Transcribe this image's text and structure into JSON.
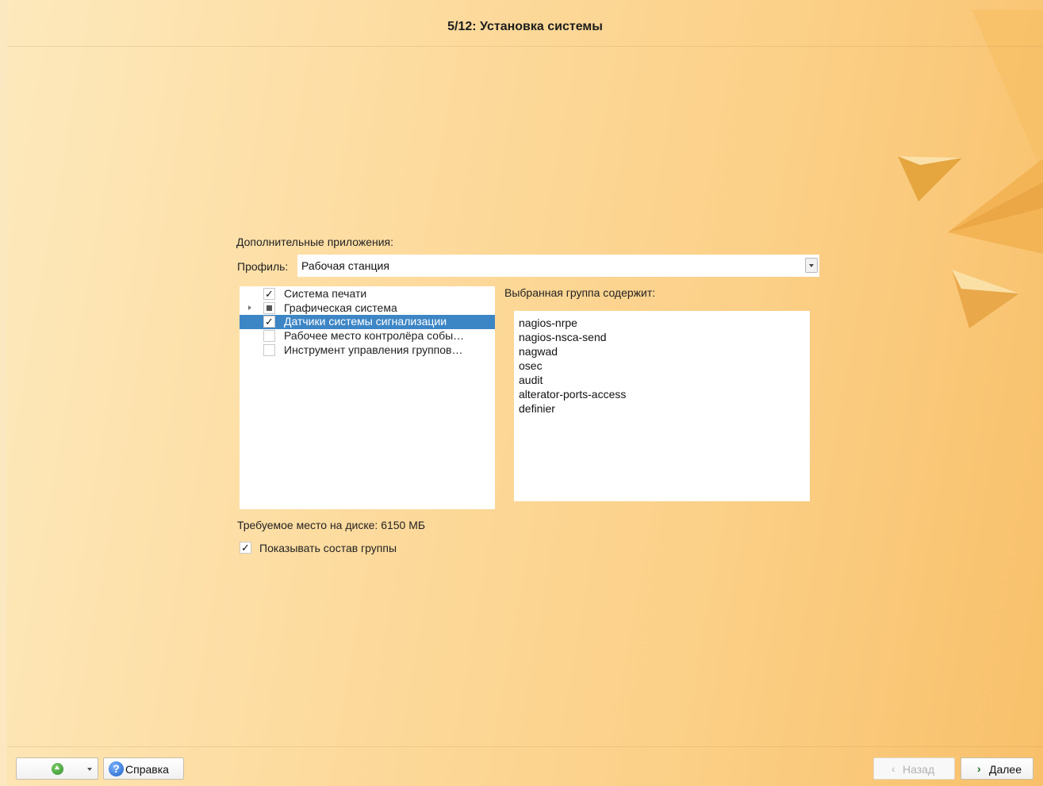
{
  "window": {
    "title": "5/12: Установка системы"
  },
  "section": {
    "heading": "Дополнительные приложения:"
  },
  "profile": {
    "label": "Профиль:",
    "value": "Рабочая станция"
  },
  "groups": {
    "items": [
      {
        "label": "Система печати",
        "state": "checked",
        "expandable": false,
        "selected": false
      },
      {
        "label": "Графическая система",
        "state": "partial",
        "expandable": true,
        "selected": false
      },
      {
        "label": "Датчики системы сигнализации",
        "state": "checked",
        "expandable": false,
        "selected": true
      },
      {
        "label": "Рабочее место контролёра собы…",
        "state": "unchecked",
        "expandable": false,
        "selected": false
      },
      {
        "label": "Инструмент управления группов…",
        "state": "unchecked",
        "expandable": false,
        "selected": false
      }
    ]
  },
  "packages": {
    "heading": "Выбранная группа содержит:",
    "items": [
      "nagios-nrpe",
      "nagios-nsca-send",
      "nagwad",
      "osec",
      "audit",
      "alterator-ports-access",
      "definier"
    ]
  },
  "disk": {
    "text": "Требуемое место на диске: 6150 МБ"
  },
  "show_group": {
    "label": "Показывать состав группы",
    "checked": true,
    "mark": "✓"
  },
  "footer": {
    "help_label": "Справка",
    "back_label": "Назад",
    "next_label": "Далее"
  },
  "colors": {
    "selection": "#3d86c6",
    "background": "#fbcf86"
  }
}
